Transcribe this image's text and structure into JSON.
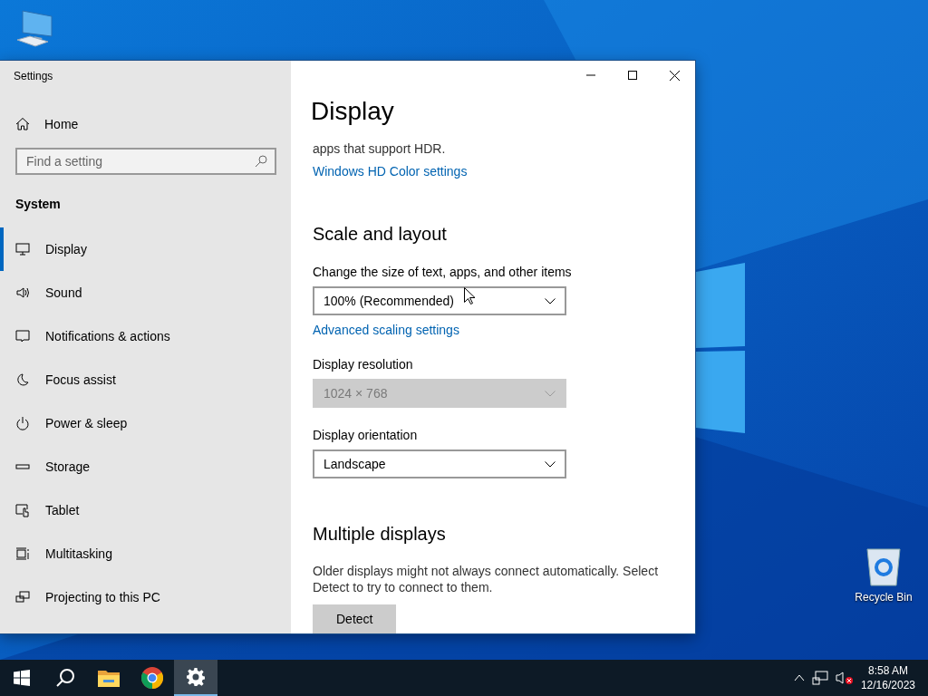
{
  "desktop_icons": [
    {
      "kind": "pc"
    },
    {
      "kind": "bin",
      "label": "Recycle Bin"
    }
  ],
  "window": {
    "title": "Settings"
  },
  "sidebar": {
    "home": "Home",
    "search": {
      "placeholder": "Find a setting"
    },
    "section": "System",
    "items": [
      {
        "kind": "display",
        "label": "Display",
        "selected": true
      },
      {
        "kind": "sound",
        "label": "Sound",
        "selected": false
      },
      {
        "kind": "notifications",
        "label": "Notifications & actions",
        "selected": false
      },
      {
        "kind": "focus",
        "label": "Focus assist",
        "selected": false
      },
      {
        "kind": "power",
        "label": "Power & sleep",
        "selected": false
      },
      {
        "kind": "storage",
        "label": "Storage",
        "selected": false
      },
      {
        "kind": "tablet",
        "label": "Tablet",
        "selected": false
      },
      {
        "kind": "multitasking",
        "label": "Multitasking",
        "selected": false
      },
      {
        "kind": "projecting",
        "label": "Projecting to this PC",
        "selected": false
      }
    ]
  },
  "content": {
    "title": "Display",
    "blocks": [
      {
        "kind": "text",
        "text": "apps that support HDR."
      },
      {
        "kind": "link",
        "text": "Windows HD Color settings"
      },
      {
        "kind": "heading",
        "text": "Scale and layout"
      },
      {
        "kind": "label",
        "text": "Change the size of text, apps, and other items"
      },
      {
        "kind": "dropdown",
        "value": "100% (Recommended)",
        "disabled": false
      },
      {
        "kind": "link",
        "text": "Advanced scaling settings"
      },
      {
        "kind": "label",
        "text": "Display resolution"
      },
      {
        "kind": "dropdown",
        "value": "1024 × 768",
        "disabled": true
      },
      {
        "kind": "label",
        "text": "Display orientation"
      },
      {
        "kind": "dropdown",
        "value": "Landscape",
        "disabled": false
      },
      {
        "kind": "heading",
        "text": "Multiple displays"
      },
      {
        "kind": "text",
        "text": "Older displays might not always connect automatically. Select Detect to try to connect to them."
      },
      {
        "kind": "button",
        "text": "Detect"
      }
    ]
  },
  "taskbar": {
    "apps": [
      {
        "kind": "start",
        "selected": false
      },
      {
        "kind": "search",
        "selected": false
      },
      {
        "kind": "explorer",
        "selected": false
      },
      {
        "kind": "chrome",
        "selected": false
      },
      {
        "kind": "settings",
        "selected": true
      }
    ],
    "time": "8:58 AM",
    "date": "12/16/2023"
  }
}
